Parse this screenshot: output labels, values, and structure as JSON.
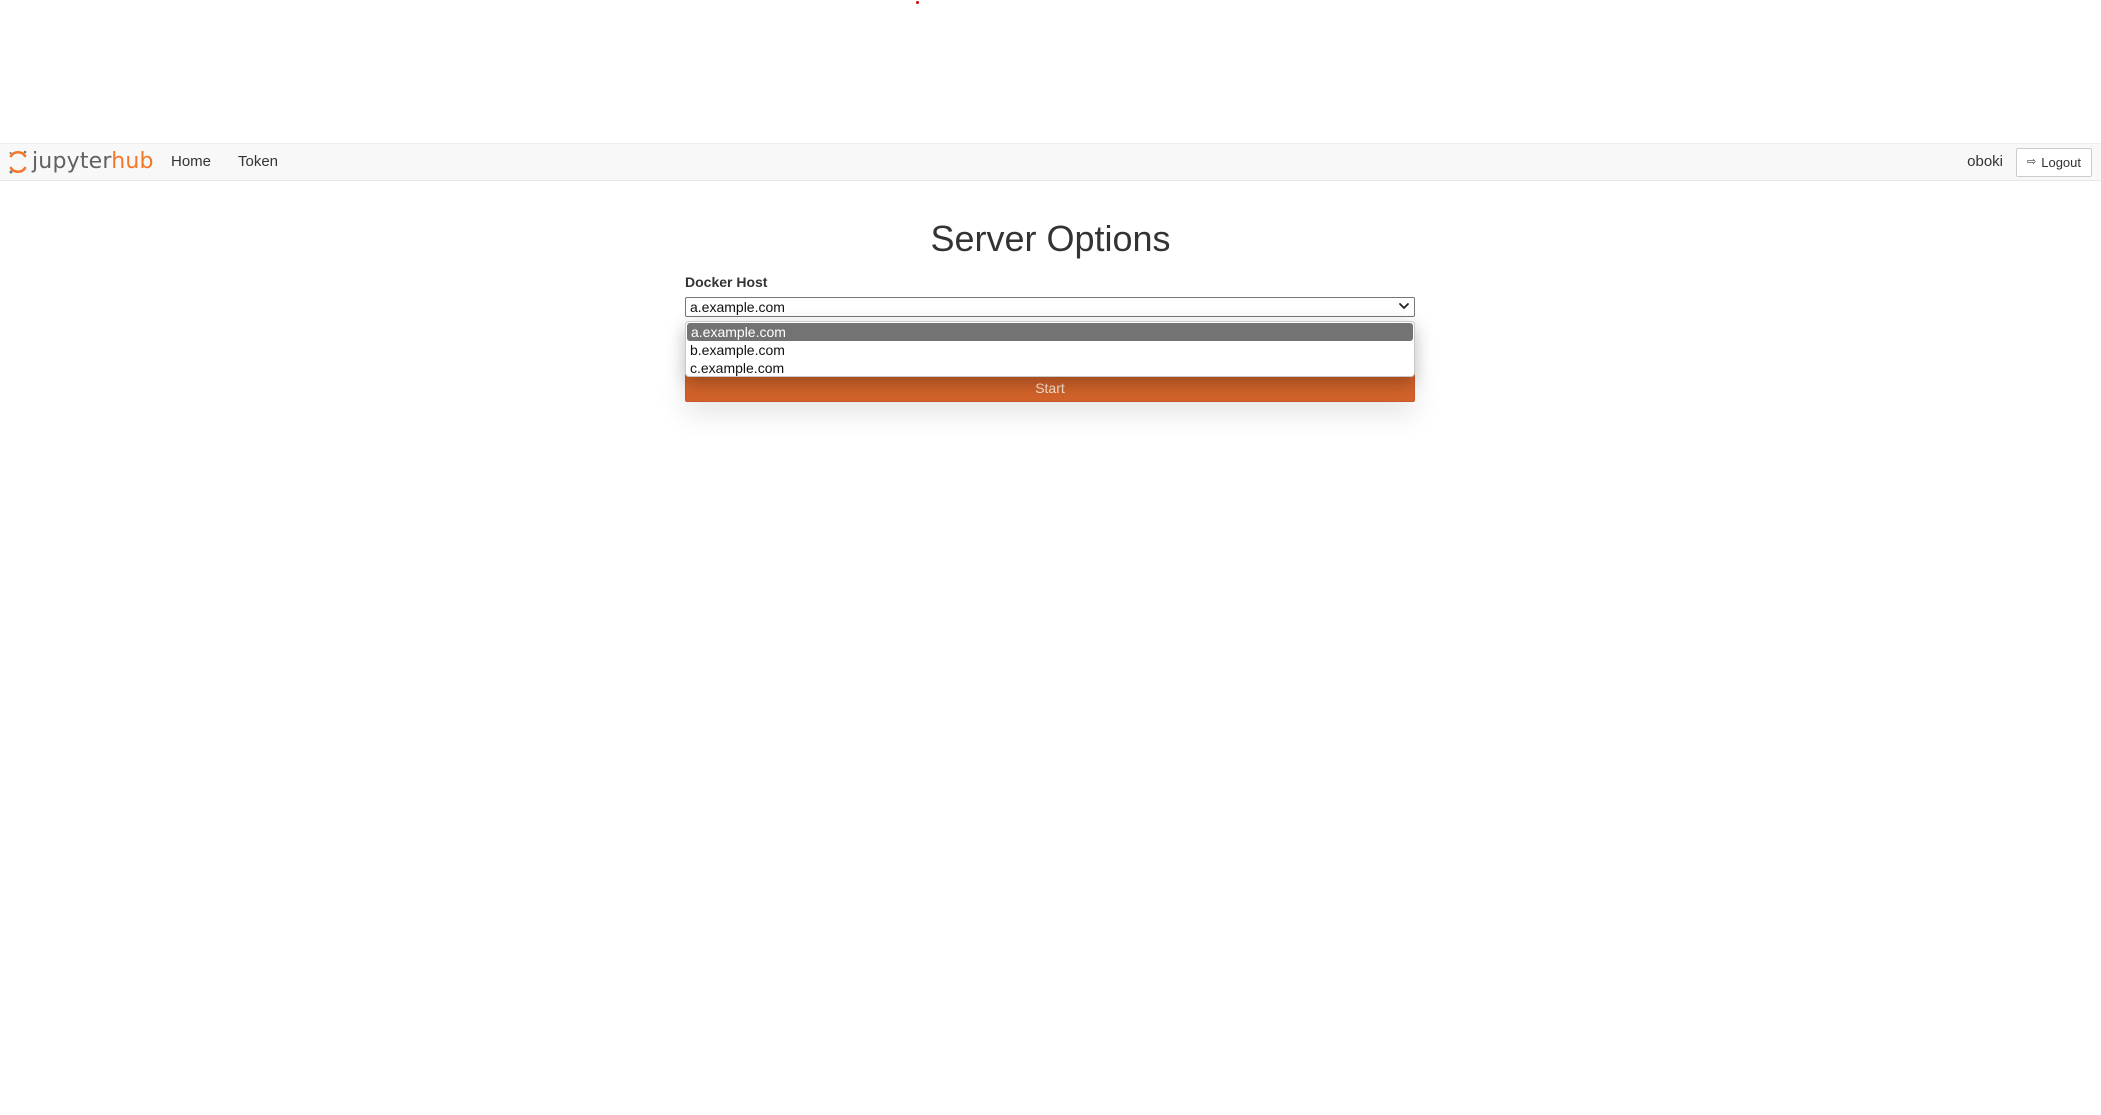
{
  "navbar": {
    "logo": {
      "part1": "jupyter",
      "part2": "hub"
    },
    "links": {
      "home": "Home",
      "token": "Token"
    },
    "username": "oboki",
    "logout_label": "Logout",
    "logout_icon": "sign-out-icon"
  },
  "main": {
    "title": "Server Options",
    "docker_host_label": "Docker Host",
    "selected_host": "a.example.com",
    "options": [
      "a.example.com",
      "b.example.com",
      "c.example.com"
    ],
    "start_label": "Start"
  },
  "colors": {
    "brand_orange": "#f37726",
    "start_button": "#d2632a",
    "selected_option": "#737373",
    "navbar_bg": "#f8f8f8"
  }
}
